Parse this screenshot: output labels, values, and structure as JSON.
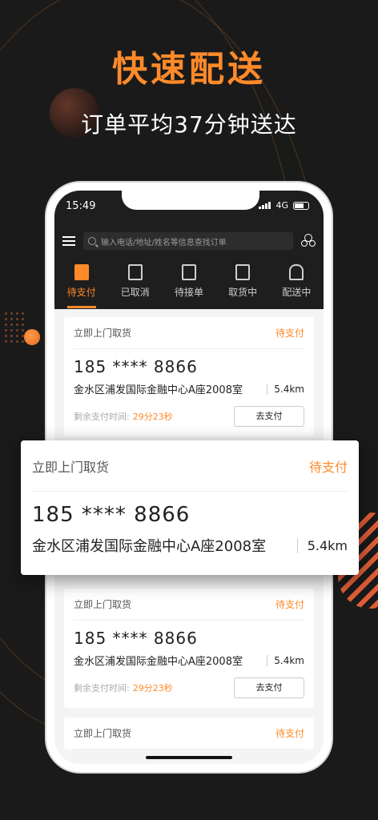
{
  "colors": {
    "accent": "#ff8a2a",
    "background": "#1a1a1a"
  },
  "hero": {
    "title": "快速配送",
    "subtitle": "订单平均37分钟送达"
  },
  "status_bar": {
    "time": "15:49",
    "network": "4G"
  },
  "search": {
    "placeholder": "输入电话/地址/姓名等信息查找订单"
  },
  "tabs": [
    {
      "label": "待支付",
      "icon": "pending-payment-icon",
      "active": true
    },
    {
      "label": "已取消",
      "icon": "cancelled-icon",
      "active": false
    },
    {
      "label": "待接单",
      "icon": "waiting-accept-icon",
      "active": false
    },
    {
      "label": "取货中",
      "icon": "pickup-box-icon",
      "active": false
    },
    {
      "label": "配送中",
      "icon": "scooter-icon",
      "active": false
    }
  ],
  "orders": [
    {
      "type": "立即上门取货",
      "status": "待支付",
      "phone": "185 **** 8866",
      "address": "金水区浦发国际金融中心A座2008室",
      "distance": "5.4km",
      "remain_label": "剩余支付时间:",
      "remain_time": "29分23秒",
      "pay_button": "去支付"
    },
    {
      "type": "立即上门取货",
      "status": "待支付",
      "phone": "185 **** 8866",
      "address": "金水区浦发国际金融中心A座2008室",
      "distance": "5.4km",
      "remain_label": "剩余支付时间:",
      "remain_time": "29分23秒",
      "pay_button": "去支付"
    },
    {
      "type": "立即上门取货",
      "status": "待支付",
      "phone": "185 **** 8866",
      "address": "金水区浦发国际金融中心A座2008室",
      "distance": "5.4km",
      "remain_label": "剩余支付时间:",
      "remain_time": "29分23秒",
      "pay_button": "去支付"
    },
    {
      "type": "立即上门取货",
      "status": "待支付"
    }
  ],
  "popup": {
    "type": "立即上门取货",
    "status": "待支付",
    "phone": "185 **** 8866",
    "address": "金水区浦发国际金融中心A座2008室",
    "distance": "5.4km"
  }
}
